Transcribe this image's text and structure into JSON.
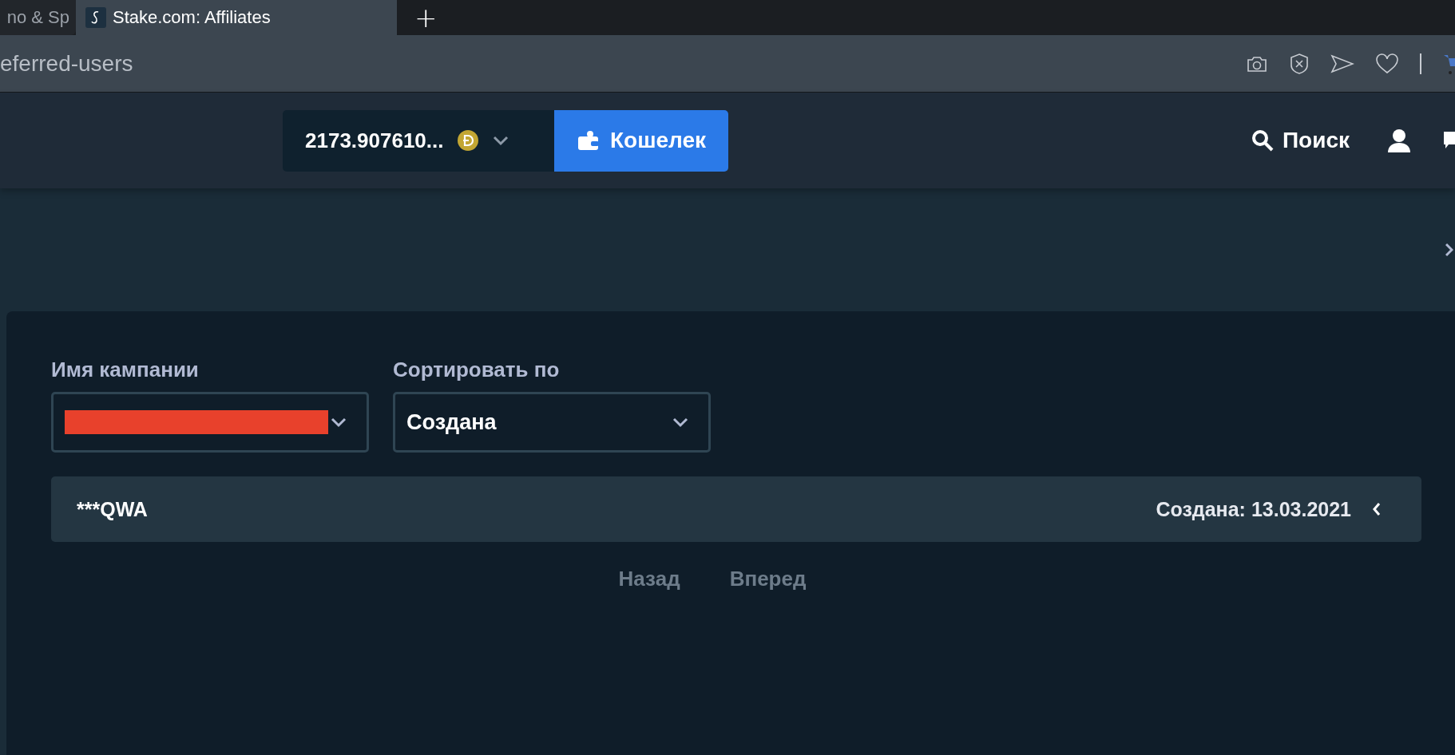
{
  "browser": {
    "tabs": [
      {
        "title": "no & Sp",
        "selected": false
      },
      {
        "title": "Stake.com: Affiliates",
        "selected": true
      }
    ],
    "new_tab": "+",
    "address": "eferred-users"
  },
  "header": {
    "balance": "2173.907610...",
    "wallet_button": "Кошелек",
    "search": "Поиск"
  },
  "filters": [
    {
      "label": "Имя кампании",
      "value_redacted": true
    },
    {
      "label": "Сортировать по",
      "value": "Создана",
      "value_redacted": false
    }
  ],
  "rows": [
    {
      "name": "***QWA",
      "created": "Создана: 13.03.2021",
      "expanded": false
    }
  ],
  "pagination": {
    "previous": "Назад",
    "next": "Вперед"
  }
}
